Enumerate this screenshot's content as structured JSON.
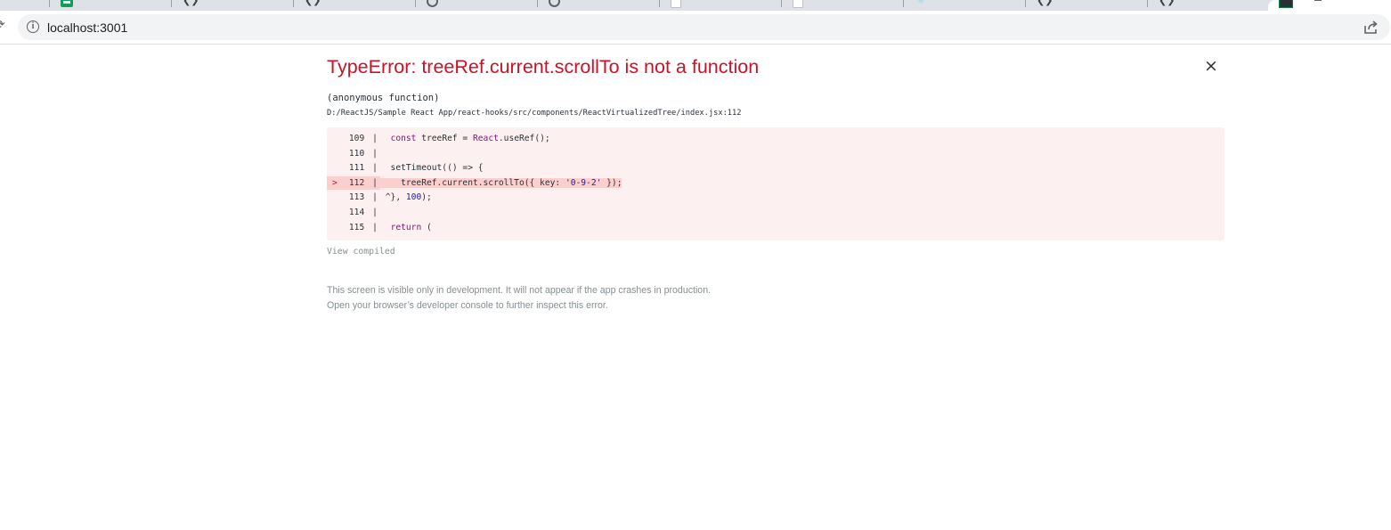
{
  "browser": {
    "tabs": [
      {
        "icon": "blank"
      },
      {
        "icon": "sheets-icon"
      },
      {
        "icon": "code-brackets-icon"
      },
      {
        "icon": "code-brackets-icon"
      },
      {
        "icon": "globe-icon"
      },
      {
        "icon": "globe-icon"
      },
      {
        "icon": "document-icon"
      },
      {
        "icon": "document-icon"
      },
      {
        "icon": "react-icon"
      },
      {
        "icon": "code-brackets-icon"
      },
      {
        "icon": "code-brackets-icon"
      },
      {
        "icon": "terminal-icon",
        "active": true
      }
    ],
    "url": "localhost:3001"
  },
  "error": {
    "title": "TypeError: treeRef.current.scrollTo is not a function",
    "close_glyph": "×",
    "function_name": "(anonymous function)",
    "file_path": "D:/ReactJS/Sample React App/react-hooks/src/components/ReactVirtualizedTree/index.jsx:112",
    "code": [
      {
        "line": "109",
        "text": "  const treeRef = React.useRef();",
        "highlight": false
      },
      {
        "line": "110",
        "text": "",
        "highlight": false
      },
      {
        "line": "111",
        "text": "  setTimeout(() => {",
        "highlight": false
      },
      {
        "line": "112",
        "text": "    treeRef.current.scrollTo({ key: '0-9-2' });",
        "highlight": true
      },
      {
        "line": "113",
        "text": " ^}, 100);",
        "highlight": false
      },
      {
        "line": "114",
        "text": "",
        "highlight": false
      },
      {
        "line": "115",
        "text": "  return (",
        "highlight": false
      }
    ],
    "marker": ">",
    "view_compiled": "View compiled",
    "footer_line1": "This screen is visible only in development. It will not appear if the app crashes in production.",
    "footer_line2": "Open your browser’s developer console to further inspect this error."
  },
  "colors": {
    "error_red": "#ce1126",
    "code_bg": "#fdf0f0",
    "highlight_bg": "#fccfcf",
    "muted": "#878e91"
  }
}
